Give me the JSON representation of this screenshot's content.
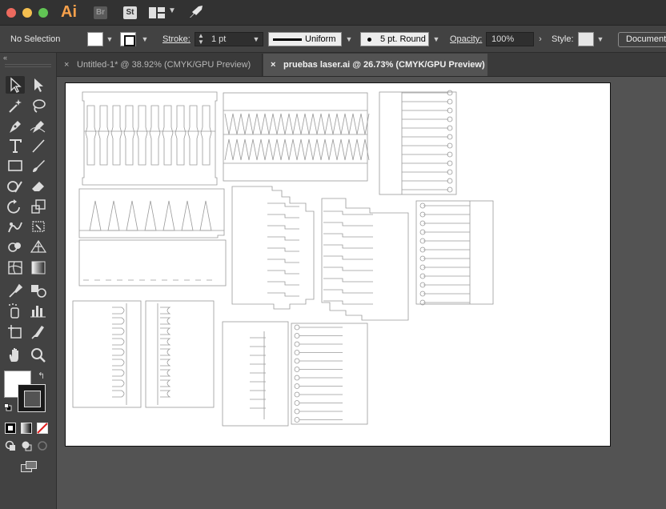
{
  "app": {
    "logo": "Ai",
    "bridge_label": "Br",
    "stock_label": "St",
    "icons": [
      "workspace-icon",
      "chevron-down-icon",
      "rocket-icon"
    ]
  },
  "window_controls": [
    "close",
    "minimize",
    "maximize"
  ],
  "control_bar": {
    "selection_label": "No Selection",
    "stroke_label": "Stroke:",
    "stroke_weight": "1 pt",
    "stroke_profile": "Uniform",
    "brush_value": "5 pt. Round",
    "opacity_label": "Opacity:",
    "opacity_value": "100%",
    "style_label": "Style:",
    "document_button": "Document"
  },
  "tabs": [
    {
      "label": "Untitled-1* @ 38.92% (CMYK/GPU Preview)",
      "active": false
    },
    {
      "label": "pruebas laser.ai @ 26.73% (CMYK/GPU Preview)",
      "active": true
    }
  ],
  "tab_close_glyph": "×",
  "toolbar": {
    "collapse_glyph": "«",
    "tools": [
      "selection-tool",
      "direct-selection-tool",
      "magic-wand-tool",
      "lasso-tool",
      "pen-tool",
      "curvature-tool",
      "type-tool",
      "line-segment-tool",
      "rectangle-tool",
      "paintbrush-tool",
      "shaper-tool",
      "eraser-tool",
      "rotate-tool",
      "scale-tool",
      "puppet-warp-tool",
      "free-transform-tool",
      "shape-builder-tool",
      "perspective-grid-tool",
      "mesh-tool",
      "gradient-tool",
      "eyedropper-tool",
      "blend-tool",
      "symbol-sprayer-tool",
      "column-graph-tool",
      "artboard-tool",
      "slice-tool",
      "hand-tool",
      "zoom-tool"
    ],
    "active_tool": "selection-tool",
    "fill_color": "#ffffff",
    "stroke_color": "#000000",
    "swap_glyph": "↰"
  },
  "colors": {
    "titlebar": "#323232",
    "panel": "#424242",
    "canvas": "#535353",
    "artboard": "#ffffff",
    "art_stroke": "#9a9a9a",
    "accent_logo": "#f7a14b"
  }
}
